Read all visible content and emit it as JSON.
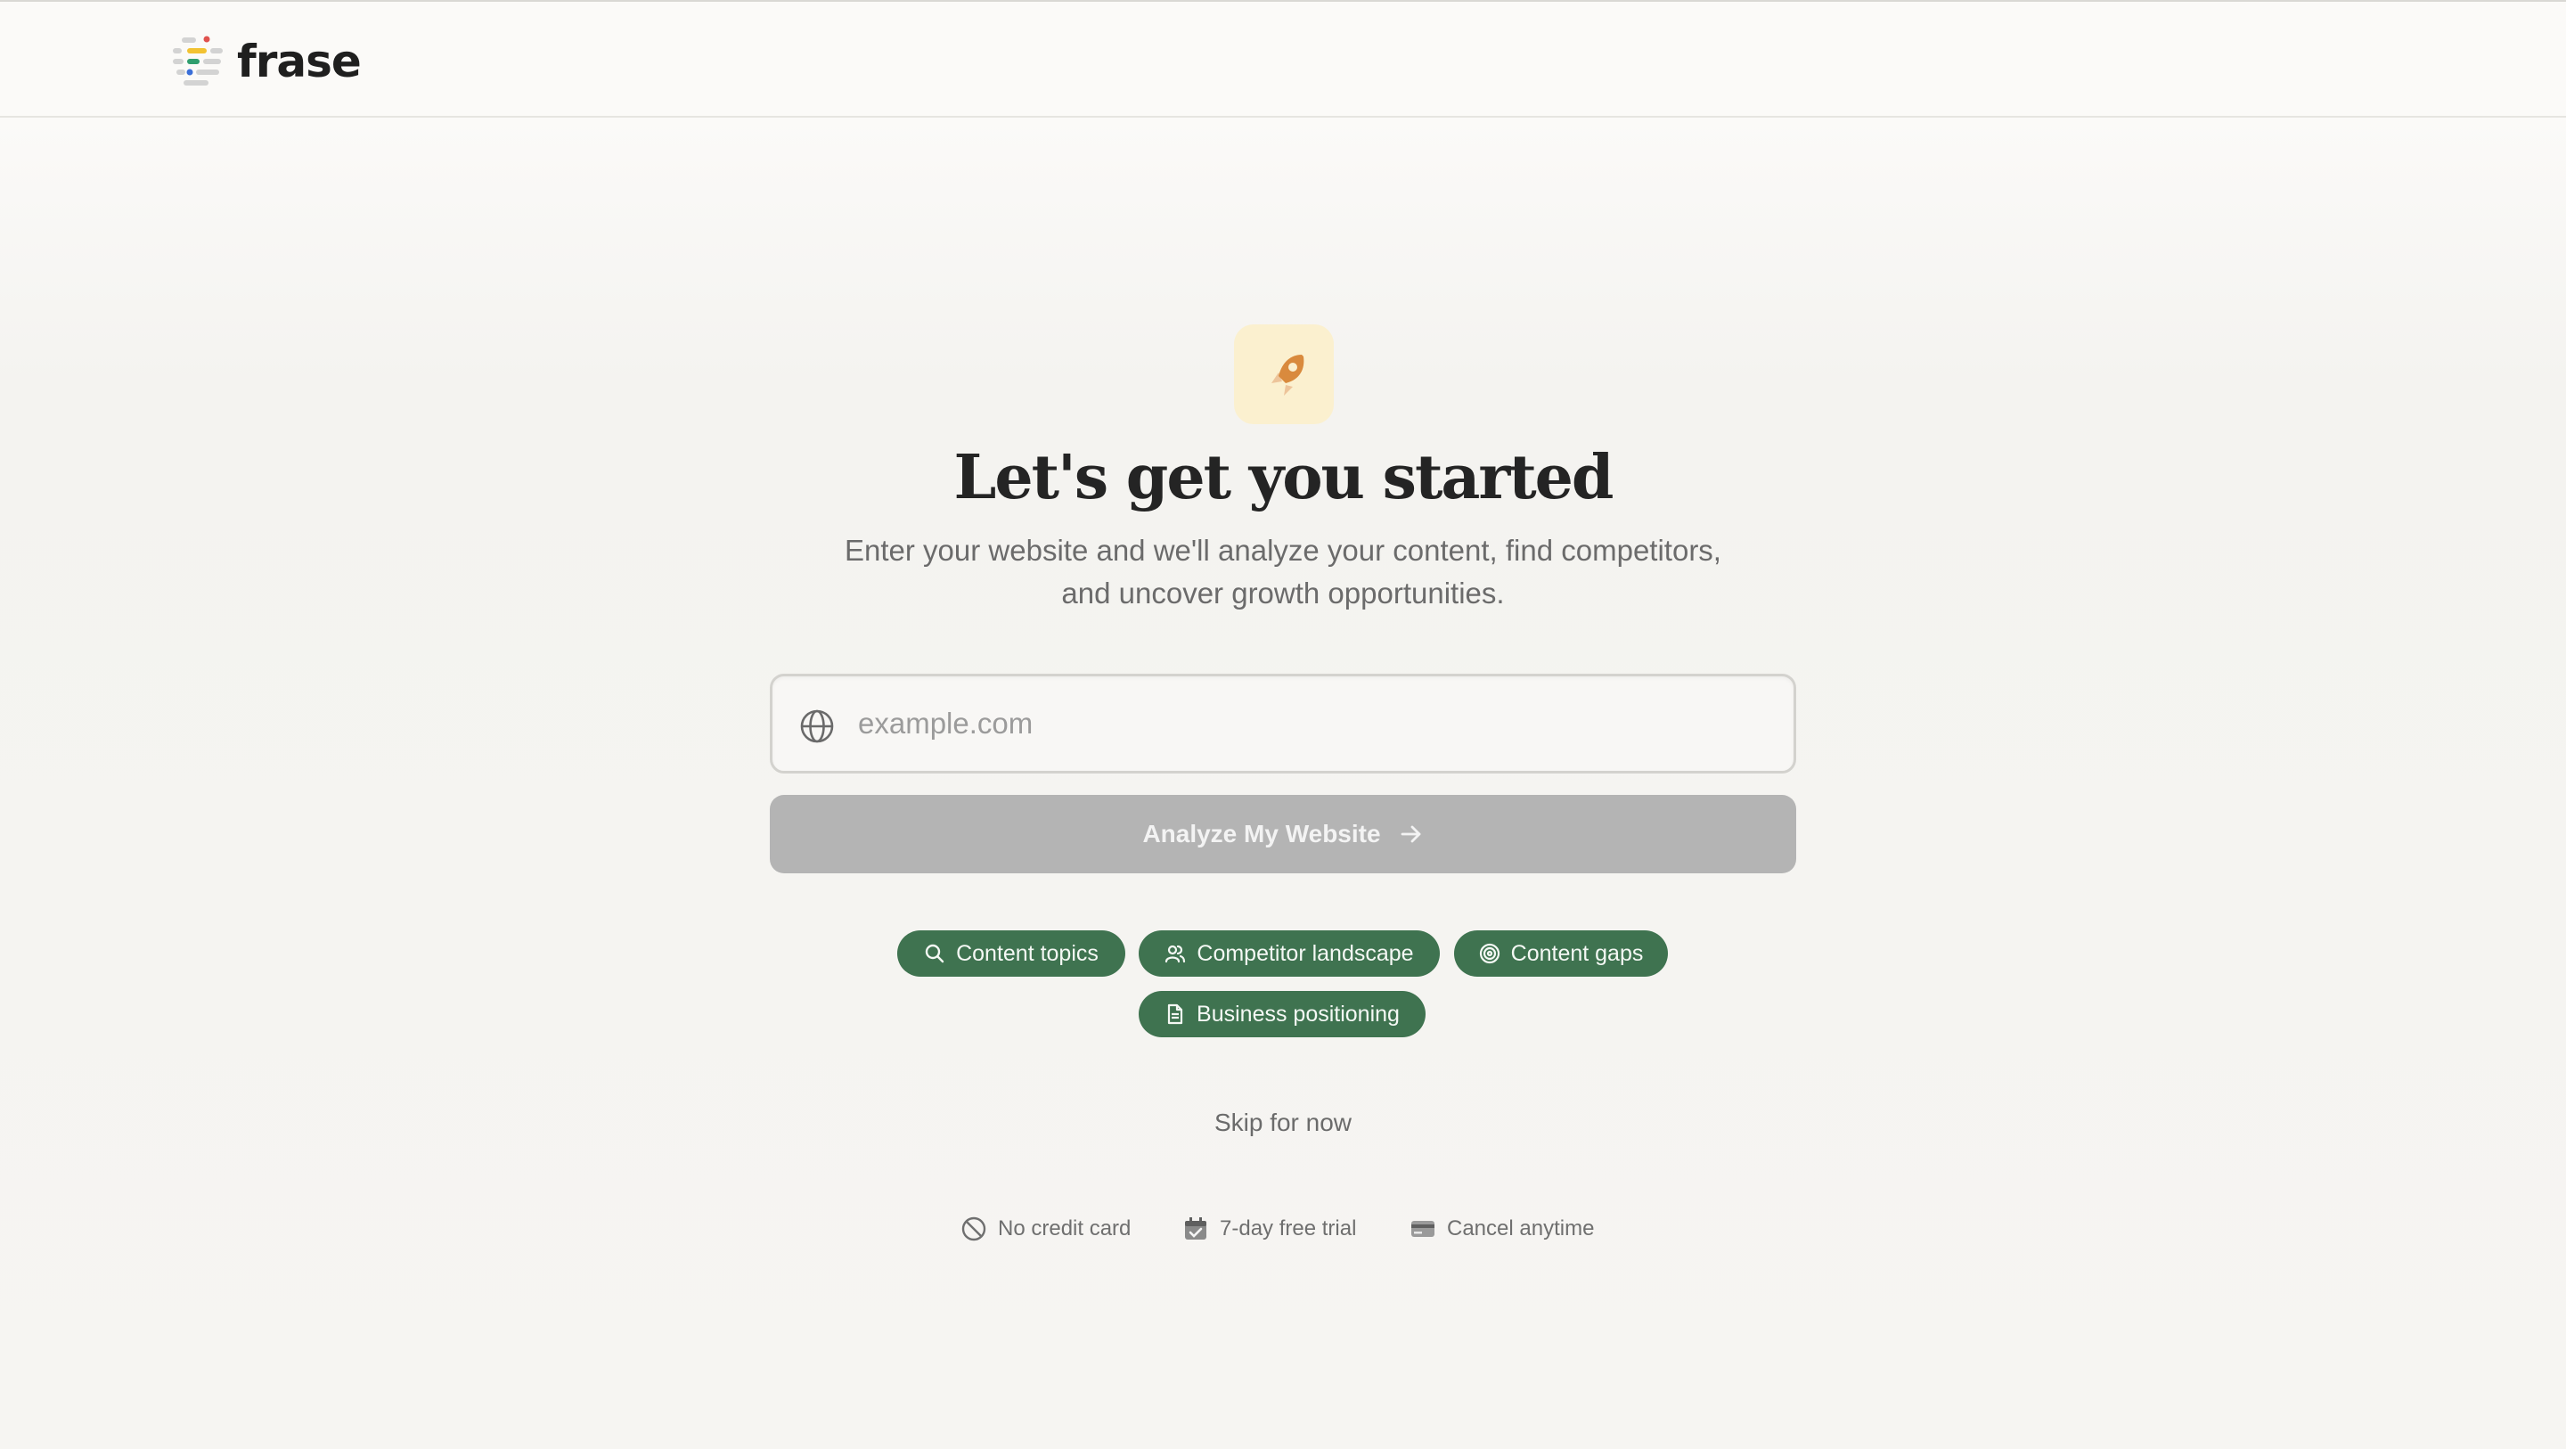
{
  "header": {
    "logo_text": "frase"
  },
  "hero": {
    "icon": "rocket-icon",
    "title": "Let's get you started",
    "subtitle": "Enter your website and we'll analyze your content, find competitors, and uncover growth opportunities."
  },
  "url_input": {
    "icon": "globe-icon",
    "placeholder": "example.com",
    "value": ""
  },
  "analyze_button": {
    "label": "Analyze My Website",
    "icon": "arrow-right-icon"
  },
  "chips": [
    {
      "label": "Content topics",
      "icon": "search-icon"
    },
    {
      "label": "Competitor landscape",
      "icon": "users-icon"
    },
    {
      "label": "Content gaps",
      "icon": "target-icon"
    },
    {
      "label": "Business positioning",
      "icon": "document-icon"
    }
  ],
  "skip_label": "Skip for now",
  "perks": [
    {
      "label": "No credit card",
      "icon": "prohibited-icon"
    },
    {
      "label": "7-day free trial",
      "icon": "calendar-check-icon"
    },
    {
      "label": "Cancel anytime",
      "icon": "credit-card-icon"
    }
  ],
  "colors": {
    "background": "#f7f6f3",
    "chip_green": "#3f7350",
    "button_disabled": "#b4b4b4",
    "rocket_bg": "#fbf0cf",
    "rocket_orange": "#d98a3d"
  }
}
